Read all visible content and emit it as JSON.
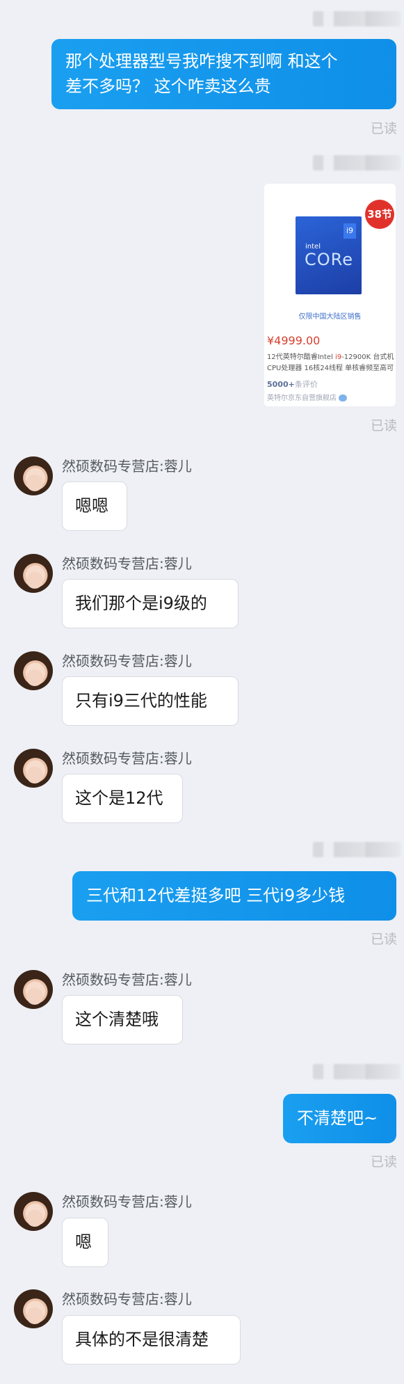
{
  "read_label": "已读",
  "sender_name": "然硕数码专营店:蓉儿",
  "messages": [
    {
      "text_line1": "那个处理器型号我咋搜不到啊   和这个",
      "text_line2": "差不多吗？   这个咋卖这么贵"
    },
    {
      "card": {
        "badge": "38节",
        "box_brand": "intel",
        "box_core": "CORe",
        "box_i9": "i9",
        "note": "仅限中国大陆区销售",
        "price": "¥4999.00",
        "title_a": "12代英特尔酷睿Intel ",
        "title_hl": "i9",
        "title_b": "-12900K 台式机CPU处理器 16核24线程 单核睿频至高可",
        "reviews_count": "5000+",
        "reviews_label": "条评价",
        "shop": "英特尔京东自营旗舰店"
      }
    },
    {
      "text": "嗯嗯"
    },
    {
      "text": "我们那个是i9级的"
    },
    {
      "text": "只有i9三代的性能"
    },
    {
      "text": "这个是12代"
    },
    {
      "text": "三代和12代差挺多吧   三代i9多少钱"
    },
    {
      "text": "这个清楚哦"
    },
    {
      "text": "不清楚吧~"
    },
    {
      "text": "嗯"
    },
    {
      "text": "具体的不是很清楚"
    }
  ],
  "colors": {
    "outgoing_bubble": "#1a9ff0",
    "background": "#eef0f5",
    "price": "#d6402f"
  }
}
